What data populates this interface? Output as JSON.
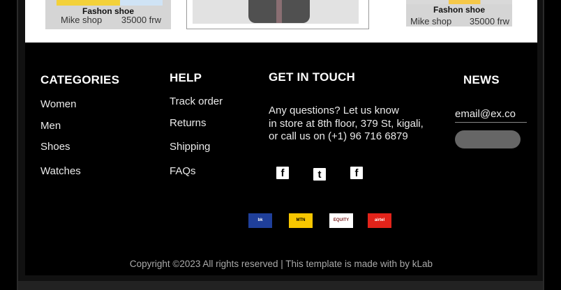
{
  "products": [
    {
      "title": "Fashon shoe",
      "shop": "Mike shop",
      "price": "35000 frw"
    },
    {
      "title": "Fashon shoe",
      "shop": "Mike shop",
      "price": "35000 frw"
    }
  ],
  "footer": {
    "categories": {
      "title": "CATEGORIES",
      "items": [
        "Women",
        "Men",
        "Shoes",
        "Watches"
      ]
    },
    "help": {
      "title": "HELP",
      "items": [
        "Track order",
        "Returns",
        "Shipping",
        "FAQs"
      ]
    },
    "contact": {
      "title": "GET IN TOUCH",
      "lines": [
        "Any questions? Let us know",
        "in store at 8th floor, 379 St, kigali,",
        "or call us on (+1) 96 716 6879"
      ],
      "social_icons": [
        "facebook-icon",
        "twitter-icon",
        "facebook-icon"
      ]
    },
    "news": {
      "title": "NEWS",
      "email_placeholder": "email@ex.co",
      "subscribe_label": ""
    },
    "payments": [
      {
        "name": "bk-logo",
        "label": "bk",
        "color": "#1f3f9a"
      },
      {
        "name": "mtn-logo",
        "label": "MTN",
        "color": "#f7c600"
      },
      {
        "name": "equity-logo",
        "label": "EQUITY",
        "color": "#ffffff"
      },
      {
        "name": "airtel-logo",
        "label": "airtel",
        "color": "#e2231a"
      }
    ],
    "copyright": "Copyright ©2023 All rights reserved | This template is made with by kLab"
  }
}
